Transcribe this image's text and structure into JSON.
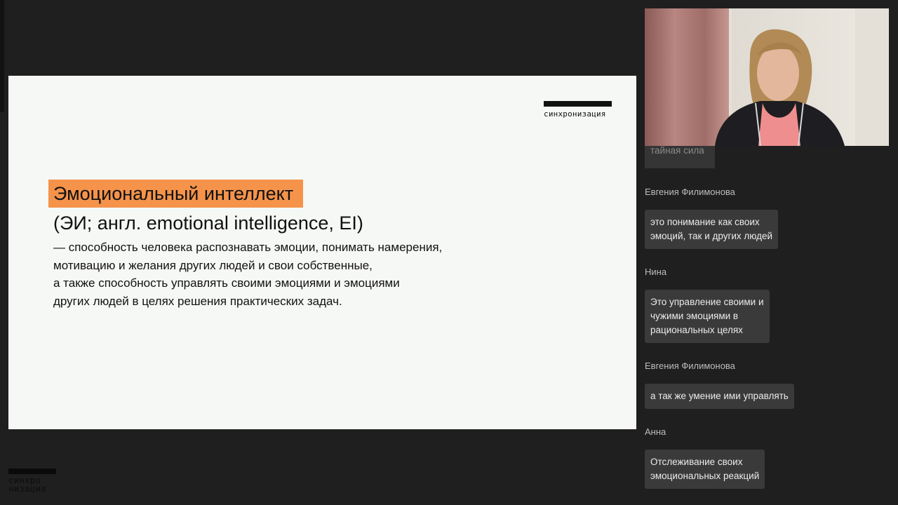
{
  "slide": {
    "logo_text": "синхронизация",
    "term": "Эмоциональный интеллект",
    "term_subtitle": "(ЭИ; англ. emotional intelligence, EI)",
    "definition_lines": [
      "— способность человека распознавать эмоции, понимать намерения,",
      "мотивацию и желания других людей и свои собственные,",
      "а также способность управлять своими эмоциями и эмоциями",
      "других людей в целях решения практических задач."
    ],
    "accent_color": "#f5934a"
  },
  "watermark": {
    "line1": "синхро",
    "line2": "низация"
  },
  "chat": {
    "cut_message": "тайная сила",
    "messages": [
      {
        "author": "Евгения Филимонова",
        "lines": [
          "это понимание как своих",
          "эмоций, так и других людей"
        ]
      },
      {
        "author": "Нина",
        "lines": [
          "Это управление своими и",
          "чужими эмоциями в",
          "рациональных целях"
        ]
      },
      {
        "author": "Евгения Филимонова",
        "lines": [
          "а так же умение ими управлять"
        ]
      },
      {
        "author": "Анна",
        "lines": [
          "Отслеживание своих",
          "эмоциональных реакций"
        ]
      }
    ]
  }
}
